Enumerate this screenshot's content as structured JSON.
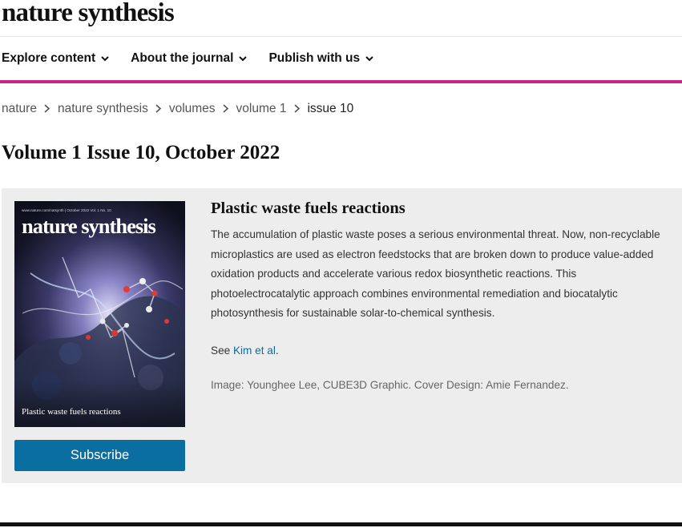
{
  "header": {
    "brand": "nature synthesis"
  },
  "nav": {
    "items": [
      {
        "label": "Explore content",
        "icon": "chevron-down-icon"
      },
      {
        "label": "About the journal",
        "icon": "chevron-down-icon"
      },
      {
        "label": "Publish with us",
        "icon": "chevron-down-icon"
      }
    ]
  },
  "breadcrumb": {
    "items": [
      "nature",
      "nature synthesis",
      "volumes",
      "volume 1"
    ],
    "current": "issue 10",
    "separator_icon": "chevron-right-icon"
  },
  "page": {
    "title": "Volume 1 Issue 10, October 2022"
  },
  "feature": {
    "cover": {
      "masthead": "nature synthesis",
      "issue_line": "www.nature.com/natsynth | October 2022 Vol. 1 No. 10",
      "caption": "Plastic waste fuels reactions"
    },
    "subscribe_label": "Subscribe",
    "headline": "Plastic waste fuels reactions",
    "description": "The accumulation of plastic waste poses a serious environmental threat. Now, non-recyclable microplastics are used as electron feedstocks that are broken down to produce value-added oxidation products and accelerate various redox biosynthetic reactions. This photoelectrocatalytic approach combines environmental remediation and biocatalytic photosynthesis for sustainable solar-to-chemical synthesis.",
    "see_prefix": "See ",
    "see_link": "Kim et al",
    "see_suffix": ".",
    "credit": "Image: Younghee Lee, CUBE3D Graphic. Cover Design: Amie Fernandez."
  },
  "colors": {
    "accent_magenta": "#c42588",
    "link_blue": "#0a6ea0",
    "panel_gray": "#ededed"
  }
}
